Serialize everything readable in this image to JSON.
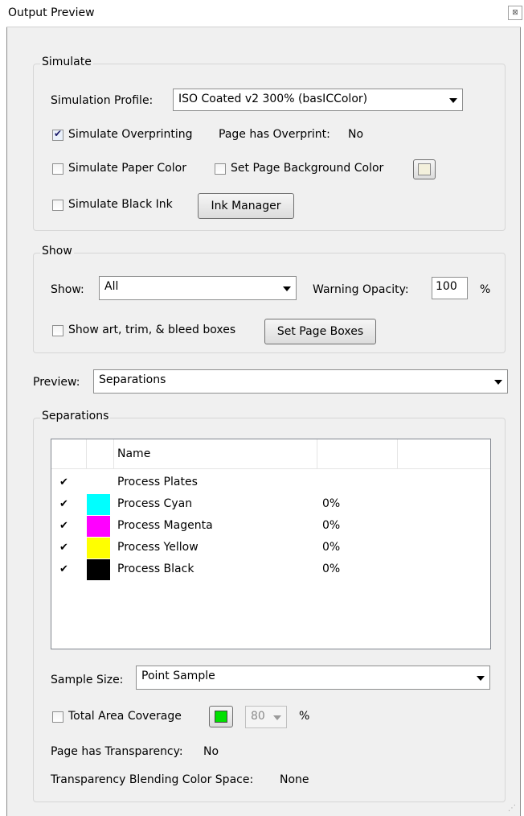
{
  "window": {
    "title": "Output Preview",
    "close_glyph": "⊠"
  },
  "simulate": {
    "label": "Simulate",
    "profile_label": "Simulation Profile:",
    "profile_value": "ISO Coated v2 300% (basICColor)",
    "overprint_label": "Simulate Overprinting",
    "overprint_checked": true,
    "page_overprint_label": "Page has Overprint:",
    "page_overprint_value": "No",
    "paper_color_label": "Simulate Paper Color",
    "paper_color_checked": false,
    "page_bg_label": "Set Page Background Color",
    "page_bg_checked": false,
    "page_bg_swatch": "#f3f0dc",
    "black_ink_label": "Simulate Black Ink",
    "black_ink_checked": false,
    "ink_manager_label": "Ink Manager"
  },
  "show": {
    "label": "Show",
    "show_label": "Show:",
    "show_value": "All",
    "warning_label": "Warning Opacity:",
    "warning_value": "100",
    "percent": "%",
    "boxes_label": "Show art, trim, & bleed boxes",
    "boxes_checked": false,
    "set_boxes_label": "Set Page Boxes"
  },
  "preview": {
    "label": "Preview:",
    "value": "Separations"
  },
  "separations": {
    "label": "Separations",
    "col_name": "Name",
    "rows": [
      {
        "checked": true,
        "color": "",
        "name": "Process Plates",
        "pct": ""
      },
      {
        "checked": true,
        "color": "#00ffff",
        "name": "Process Cyan",
        "pct": "0%"
      },
      {
        "checked": true,
        "color": "#ff00ff",
        "name": "Process Magenta",
        "pct": "0%"
      },
      {
        "checked": true,
        "color": "#ffff00",
        "name": "Process Yellow",
        "pct": "0%"
      },
      {
        "checked": true,
        "color": "#000000",
        "name": "Process Black",
        "pct": "0%"
      }
    ],
    "sample_label": "Sample Size:",
    "sample_value": "Point Sample",
    "tac_label": "Total Area Coverage",
    "tac_checked": false,
    "tac_swatch": "#00e000",
    "tac_value": "80",
    "tac_percent": "%",
    "transparency_label": "Page has Transparency:",
    "transparency_value": "No",
    "blend_label": "Transparency Blending Color Space:",
    "blend_value": "None"
  }
}
